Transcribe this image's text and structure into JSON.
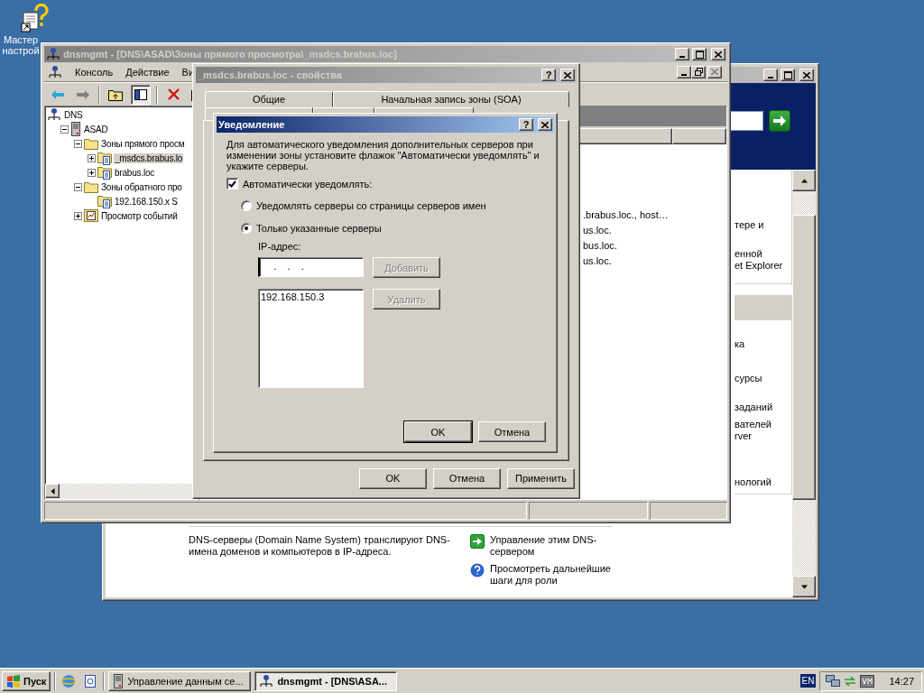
{
  "desktop_icon": {
    "label": "Мастер настрой"
  },
  "server_manager": {
    "top_fragments": [
      "тере и",
      "енной",
      "et Explorer"
    ],
    "section_fragments": [
      "ка",
      "сурсы",
      "заданий",
      "вателей",
      "rver",
      "нологий"
    ],
    "description": "DNS-серверы (Domain Name System) транслируют DNS-имена доменов и компьютеров в IP-адреса.",
    "links": [
      {
        "kind": "manage",
        "text": "Управление этим DNS-сервером"
      },
      {
        "kind": "help",
        "text": "Просмотреть дальнейшие шаги для роли"
      }
    ]
  },
  "mmc": {
    "title": "dnsmgmt - [DNS\\ASAD\\Зоны прямого просмотра\\_msdcs.brabus.loc]",
    "menu": [
      "Консоль",
      "Действие",
      "Ви"
    ],
    "tree": [
      {
        "label": "DNS",
        "kind": "dns",
        "selected": false,
        "children": [
          {
            "label": "ASAD",
            "kind": "server",
            "expanded": true,
            "selected": false,
            "children": [
              {
                "label": "Зоны прямого просм",
                "kind": "folder",
                "expanded": true,
                "selected": false,
                "children": [
                  {
                    "label": "_msdcs.brabus.lo",
                    "kind": "zone",
                    "expanded": false,
                    "selected": true
                  },
                  {
                    "label": "brabus.loc",
                    "kind": "zone",
                    "expanded": false,
                    "selected": false
                  }
                ]
              },
              {
                "label": "Зоны обратного про",
                "kind": "folder",
                "expanded": true,
                "selected": false,
                "children": [
                  {
                    "label": "192.168.150.x S",
                    "kind": "zone",
                    "selected": false
                  }
                ]
              },
              {
                "label": "Просмотр событий",
                "kind": "events",
                "expanded": false,
                "selected": false
              }
            ]
          }
        ]
      }
    ],
    "list_items": [
      ".brabus.loc., host…",
      "us.loc.",
      "bus.loc.",
      "us.loc."
    ]
  },
  "properties": {
    "title": "_msdcs.brabus.loc - свойства",
    "help_button": "?",
    "tabs": [
      {
        "label": "Общие",
        "selected": false
      },
      {
        "label": "Начальная запись зоны (SOA)",
        "selected": false
      }
    ],
    "buttons": [
      "OK",
      "Отмена",
      "Применить"
    ]
  },
  "notify": {
    "title": "Уведомление",
    "help_button": "?",
    "intro": "Для автоматического уведомления дополнительных серверов при изменении зоны установите флажок \"Автоматически уведомлять\" и укажите серверы.",
    "auto_notify": {
      "label": "Автоматически уведомлять:",
      "checked": true
    },
    "options": [
      {
        "label": "Уведомлять серверы со страницы серверов имен",
        "selected": false
      },
      {
        "label": "Только указанные серверы",
        "selected": true
      }
    ],
    "ip_label": "IP-адрес:",
    "ip_value": "   .    .    .",
    "add_button": {
      "label": "Добавить",
      "disabled": true
    },
    "servers": [
      "192.168.150.3"
    ],
    "remove_button": {
      "label": "Удалить",
      "disabled": true
    },
    "buttons": [
      "OK",
      "Отмена"
    ]
  },
  "taskbar": {
    "start": "Пуск",
    "tasks": [
      {
        "label": "Управление данным се...",
        "kind": "server",
        "selected": false
      },
      {
        "label": "dnsmgmt - [DNS\\ASA...",
        "kind": "dns",
        "selected": true
      }
    ],
    "language": "EN",
    "clock": "14:27"
  }
}
